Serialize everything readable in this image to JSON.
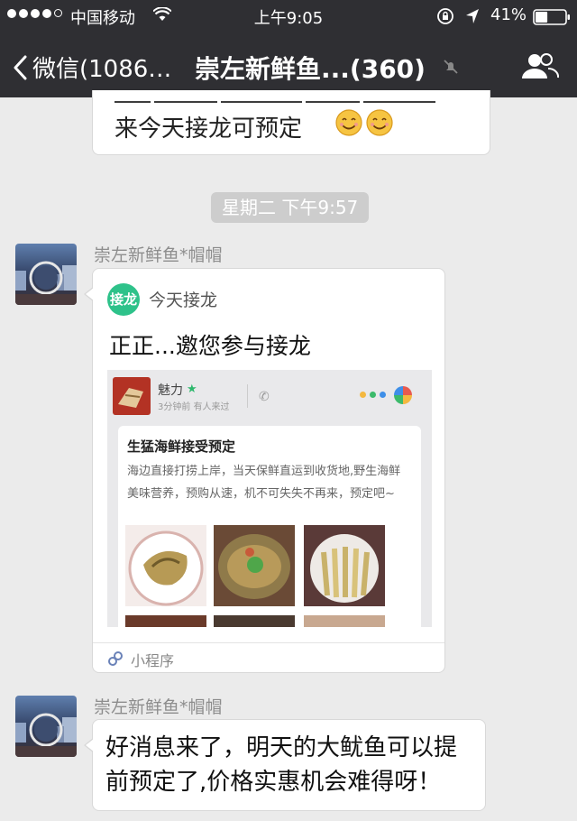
{
  "status_bar": {
    "carrier": "中国移动",
    "time": "上午9:05",
    "battery_percent": "41%",
    "battery_level": 0.41
  },
  "nav": {
    "back_label": "微信(1086…",
    "title": "崇左新鲜鱼...(360)",
    "icons": [
      "chevron-left-icon",
      "mute-icon",
      "group-members-icon"
    ]
  },
  "chat": {
    "previous_message": {
      "text": "来今天接龙可预定"
    },
    "timestamp": "星期二 下午9:57",
    "mini_program_message": {
      "sender": "崇左新鲜鱼*帽帽",
      "mini_app_logo": "接龙",
      "mini_app_name": "今天接龙",
      "title": "正正...邀您参与接龙",
      "preview": {
        "user_name": "魅力",
        "meta": "3分钟前   有人来过",
        "post_title": "生猛海鲜接受预定",
        "post_text": "海边直接打捞上岸，当天保鲜直运到收货地,野生海鲜美味营养，预购从速，机不可失失不再来，预定吧~"
      },
      "footer_label": "小程序"
    },
    "last_message": {
      "sender": "崇左新鲜鱼*帽帽",
      "text": "好消息来了，明天的大鱿鱼可以提前预定了,价格实惠机会难得呀！"
    }
  },
  "colors": {
    "nav_bg": "#2f2f33",
    "chat_bg": "#ebebeb",
    "mini_app_green": "#2ec28a"
  }
}
